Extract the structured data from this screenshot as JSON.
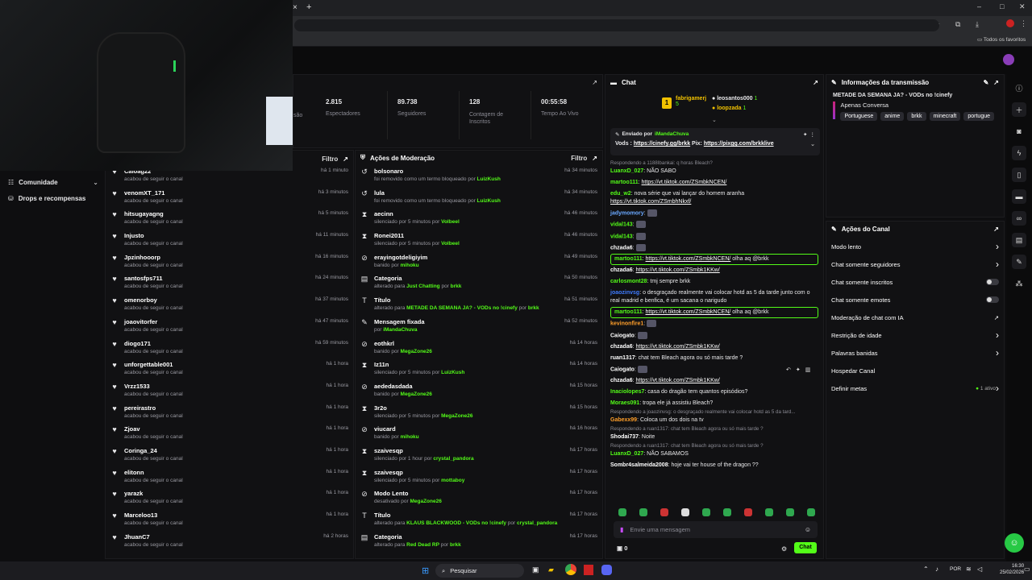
{
  "browser": {
    "bookmarks_label": "Todos os favoritos",
    "close_tab": "×",
    "new_tab": "+"
  },
  "stats": [
    {
      "value": "2.815",
      "label": "Espectadores"
    },
    {
      "value": "89.738",
      "label": "Seguidores"
    },
    {
      "value": "128",
      "label": "Contagem de Inscritos"
    },
    {
      "value": "00:55:58",
      "label": "Tempo Ao Vivo"
    }
  ],
  "stats_cut_label": "são",
  "leftnav": {
    "items": [
      {
        "label": "Comunidade"
      },
      {
        "label": "Drops e recompensas"
      }
    ]
  },
  "follows": {
    "filter": "Filtro",
    "rows": [
      {
        "name": "Caioag22",
        "action": "acabou de seguir o canal",
        "time": "há 1 minuto"
      },
      {
        "name": "venomXT_171",
        "action": "acabou de seguir o canal",
        "time": "há 3 minutos"
      },
      {
        "name": "hitsugayagng",
        "action": "acabou de seguir o canal",
        "time": "há 5 minutos"
      },
      {
        "name": "Injusto",
        "action": "acabou de seguir o canal",
        "time": "há 11 minutos"
      },
      {
        "name": "Jpzinhooorp",
        "action": "acabou de seguir o canal",
        "time": "há 16 minutos"
      },
      {
        "name": "santosfps711",
        "action": "acabou de seguir o canal",
        "time": "há 24 minutos"
      },
      {
        "name": "omenorboy",
        "action": "acabou de seguir o canal",
        "time": "há 37 minutos"
      },
      {
        "name": "joaovitorfer",
        "action": "acabou de seguir o canal",
        "time": "há 47 minutos"
      },
      {
        "name": "diogo171",
        "action": "acabou de seguir o canal",
        "time": "há 59 minutos"
      },
      {
        "name": "unforgettable001",
        "action": "acabou de seguir o canal",
        "time": "há 1 hora"
      },
      {
        "name": "Vrzz1533",
        "action": "acabou de seguir o canal",
        "time": "há 1 hora"
      },
      {
        "name": "pereirastro",
        "action": "acabou de seguir o canal",
        "time": "há 1 hora"
      },
      {
        "name": "Zjoav",
        "action": "acabou de seguir o canal",
        "time": "há 1 hora"
      },
      {
        "name": "Coringa_24",
        "action": "acabou de seguir o canal",
        "time": "há 1 hora"
      },
      {
        "name": "elitonn",
        "action": "acabou de seguir o canal",
        "time": "há 1 hora"
      },
      {
        "name": "yarazk",
        "action": "acabou de seguir o canal",
        "time": "há 1 hora"
      },
      {
        "name": "Marceloo13",
        "action": "acabou de seguir o canal",
        "time": "há 1 hora"
      },
      {
        "name": "JhuanC7",
        "action": "acabou de seguir o canal",
        "time": "há 2 horas"
      }
    ]
  },
  "mod": {
    "title": "Ações de Moderação",
    "filter": "Filtro",
    "rows": [
      {
        "icon": "↺",
        "name": "bolsonaro",
        "pre": "foi removido como um termo bloqueado por ",
        "by": "LuizKush",
        "mid": "",
        "extra": "",
        "time": "há 34 minutos"
      },
      {
        "icon": "↺",
        "name": "lula",
        "pre": "foi removido como um termo bloqueado por ",
        "by": "LuizKush",
        "mid": "",
        "extra": "",
        "time": "há 34 minutos"
      },
      {
        "icon": "⧗",
        "name": "aecinn",
        "pre": "silenciado por 5 minutos por ",
        "by": "Volbeel",
        "mid": "",
        "extra": "",
        "time": "há 46 minutos"
      },
      {
        "icon": "⧗",
        "name": "Ronei2011",
        "pre": "silenciado por 5 minutos por ",
        "by": "Volbeel",
        "mid": "",
        "extra": "",
        "time": "há 46 minutos"
      },
      {
        "icon": "⊘",
        "name": "erayingotdeligiyim",
        "pre": "banido por ",
        "by": "mihoku",
        "mid": "",
        "extra": "",
        "time": "há 49 minutos"
      },
      {
        "icon": "▤",
        "name": "Categoria",
        "pre": "alterado para ",
        "by": "Just Chatting",
        "mid": " por ",
        "extra": "brkk",
        "time": "há 50 minutos"
      },
      {
        "icon": "T",
        "name": "Título",
        "pre": "alterado para ",
        "by": "METADE DA SEMANA JA? - VODs no !cinefy",
        "mid": " por ",
        "extra": "brkk",
        "time": "há 51 minutos"
      },
      {
        "icon": "✎",
        "name": "Mensagem fixada",
        "pre": "por ",
        "by": "iMandaChuva",
        "mid": "",
        "extra": "",
        "time": "há 52 minutos"
      },
      {
        "icon": "⊘",
        "name": "eothkrl",
        "pre": "banido por ",
        "by": "MegaZone26",
        "mid": "",
        "extra": "",
        "time": "há 14 horas"
      },
      {
        "icon": "⧗",
        "name": "Iz11n",
        "pre": "silenciado por 5 minutos por ",
        "by": "LuizKush",
        "mid": "",
        "extra": "",
        "time": "há 14 horas"
      },
      {
        "icon": "⊘",
        "name": "aededasdada",
        "pre": "banido por ",
        "by": "MegaZone26",
        "mid": "",
        "extra": "",
        "time": "há 15 horas"
      },
      {
        "icon": "⧗",
        "name": "3r2o",
        "pre": "silenciado por 5 minutos por ",
        "by": "MegaZone26",
        "mid": "",
        "extra": "",
        "time": "há 15 horas"
      },
      {
        "icon": "⊘",
        "name": "viucard",
        "pre": "banido por ",
        "by": "mihoku",
        "mid": "",
        "extra": "",
        "time": "há 16 horas"
      },
      {
        "icon": "⧗",
        "name": "szaivesqp",
        "pre": "silenciado por 1 hour por ",
        "by": "crystal_pandora",
        "mid": "",
        "extra": "",
        "time": "há 17 horas"
      },
      {
        "icon": "⧗",
        "name": "szaivesqp",
        "pre": "silenciado por 5 minutos por ",
        "by": "mottaboy",
        "mid": "",
        "extra": "",
        "time": "há 17 horas"
      },
      {
        "icon": "⊘",
        "name": "Modo Lento",
        "pre": "desativado por ",
        "by": "MegaZone26",
        "mid": "",
        "extra": "",
        "time": "há 17 horas"
      },
      {
        "icon": "T",
        "name": "Título",
        "pre": "alterado para ",
        "by": "KLAUS BLACKWOOD - VODs no !cinefy",
        "mid": " por ",
        "extra": "crystal_pandora",
        "time": "há 17 horas"
      },
      {
        "icon": "▤",
        "name": "Categoria",
        "pre": "alterado para ",
        "by": "Red Dead RP",
        "mid": " por ",
        "extra": "brkk",
        "time": "há 17 horas"
      }
    ]
  },
  "chat": {
    "title": "Chat",
    "top": [
      {
        "name": "fabrigamerj",
        "count": "5"
      },
      {
        "name": "leosantos000",
        "count": "1"
      },
      {
        "name": "loopzada",
        "count": "1"
      }
    ],
    "top_rank": "1",
    "pinned": {
      "by_label": "Enviado por",
      "by": "iMandaChuva",
      "text": "Vods : ",
      "link1": "https://cinefy.gg/brkk",
      "mid": " Pix: ",
      "link2": "https://pixgg.com/brkklive"
    },
    "messages": [
      {
        "reply": "Respondendo a 1188Ibankai: q horas Bleach?",
        "user": "LuanxD_027",
        "color": "#53fc18",
        "text": "NÃO SABO",
        "link": "",
        "after": "",
        "hl": false
      },
      {
        "reply": "",
        "user": "martoo111",
        "color": "#53fc18",
        "text": "",
        "link": "https://vt.tiktok.com/ZSmbkNCEN/",
        "after": "",
        "hl": false
      },
      {
        "reply": "",
        "user": "edu_w2",
        "color": "#53fc18",
        "text": "nova série que vai lançar do homem aranha",
        "link": "https://vt.tiktok.com/ZSmbhNkxf/",
        "after": "",
        "hl": false
      },
      {
        "reply": "",
        "user": "jadymomory",
        "color": "#6aa8ff",
        "text": "",
        "link": "",
        "after": "",
        "hl": false
      },
      {
        "reply": "",
        "user": "vidal143",
        "color": "#53fc18",
        "text": "",
        "link": "",
        "after": "",
        "hl": false
      },
      {
        "reply": "",
        "user": "vidal143",
        "color": "#53fc18",
        "text": "",
        "link": "",
        "after": "",
        "hl": false
      },
      {
        "reply": "",
        "user": "chzada6",
        "color": "#ffffff",
        "text": "",
        "link": "",
        "after": "",
        "hl": false
      },
      {
        "reply": "",
        "user": "martoo111",
        "color": "#53fc18",
        "text": "",
        "link": "https://vt.tiktok.com/ZSmbkNCEN/",
        "after": " olha aq @brkk",
        "hl": true
      },
      {
        "reply": "",
        "user": "chzada6",
        "color": "#ffffff",
        "text": "",
        "link": "https://vt.tiktok.com/ZSmbk1KKw/",
        "after": "",
        "hl": false
      },
      {
        "reply": "",
        "user": "carlosmont28",
        "color": "#53fc18",
        "text": "tmj sempre brkk",
        "link": "",
        "after": "",
        "hl": false
      },
      {
        "reply": "",
        "user": "joaozinvsg",
        "color": "#3f7cff",
        "text": "o desgraçado realmente vai colocar hotd as 5 da tarde junto com o real madrid e benfica, é um sacana o narigudo",
        "link": "",
        "after": "",
        "hl": false
      },
      {
        "reply": "",
        "user": "martoo111",
        "color": "#53fc18",
        "text": "",
        "link": "https://vt.tiktok.com/ZSmbkNCEN/",
        "after": " olha aq @brkk",
        "hl": true
      },
      {
        "reply": "",
        "user": "kevinonfire1",
        "color": "#ff9f2a",
        "text": "",
        "link": "",
        "after": "",
        "hl": false
      },
      {
        "reply": "",
        "user": "Caiogato",
        "color": "#ffffff",
        "text": "",
        "link": "",
        "after": "",
        "hl": false
      },
      {
        "reply": "",
        "user": "chzada6",
        "color": "#ffffff",
        "text": "",
        "link": "https://vt.tiktok.com/ZSmbk1KKw/",
        "after": "",
        "hl": false
      },
      {
        "reply": "",
        "user": "ruan1317",
        "color": "#ffffff",
        "text": "chat tem Bleach agora ou só mais tarde ?",
        "link": "",
        "after": "",
        "hl": false
      },
      {
        "reply": "",
        "user": "Caiogato",
        "color": "#ffffff",
        "text": "",
        "link": "",
        "after": "",
        "hl": false
      },
      {
        "reply": "",
        "user": "chzada6",
        "color": "#ffffff",
        "text": "",
        "link": "https://vt.tiktok.com/ZSmbk1KKw/",
        "after": "",
        "hl": false
      },
      {
        "reply": "",
        "user": "Inaciolopes7",
        "color": "#53fc18",
        "text": "casa do dragão tem quantos episódios?",
        "link": "",
        "after": "",
        "hl": false
      },
      {
        "reply": "",
        "user": "Moraes091",
        "color": "#53fc18",
        "text": "tropa ele já assistiu Bleach?",
        "link": "",
        "after": "",
        "hl": false
      },
      {
        "reply": "Respondendo a joaozinvsg: o desgraçado realmente vai colocar hotd as 5 da tard...",
        "user": "Gabexx99",
        "color": "#ff9f2a",
        "text": "Coloca um dos dois na tv",
        "link": "",
        "after": "",
        "hl": false
      },
      {
        "reply": "Respondendo a ruan1317: chat tem Bleach agora ou só mais tarde ?",
        "user": "Shodai737",
        "color": "#ffffff",
        "text": "Noite",
        "link": "",
        "after": "",
        "hl": false
      },
      {
        "reply": "Respondendo a ruan1317: chat tem Bleach agora ou só mais tarde ?",
        "user": "LuanxD_027",
        "color": "#53fc18",
        "text": "NÃO SABAMOS",
        "link": "",
        "after": "",
        "hl": false
      },
      {
        "reply": "",
        "user": "Sombr4salmeida2008",
        "color": "#ffffff",
        "text": "hoje vai ter house of the dragon ??",
        "link": "",
        "after": "",
        "hl": false
      }
    ],
    "input_placeholder": "Envie uma mensagem",
    "points": "0",
    "send": "Chat"
  },
  "info": {
    "title": "Informações da transmissão",
    "stream_title": "METADE DA SEMANA JA? - VODs no !cinefy",
    "category": "Apenas Conversa",
    "tags": [
      "Portuguese",
      "anime",
      "brkk",
      "minecraft",
      "portugue"
    ]
  },
  "actions": {
    "title": "Ações do Canal",
    "items": [
      {
        "label": "Modo lento",
        "ctl": "chevron"
      },
      {
        "label": "Chat somente seguidores",
        "ctl": "chevron"
      },
      {
        "label": "Chat somente inscritos",
        "ctl": "toggle"
      },
      {
        "label": "Chat somente emotes",
        "ctl": "toggle"
      },
      {
        "label": "Moderação de chat com IA",
        "ctl": "external"
      },
      {
        "label": "Restrição de idade",
        "ctl": "chevron"
      },
      {
        "label": "Palavras banidas",
        "ctl": "chevron"
      },
      {
        "label": "Hospedar Canal",
        "ctl": "none"
      },
      {
        "label": "Definir metas",
        "ctl": "badge",
        "badge": "1 ativo"
      }
    ]
  },
  "taskbar": {
    "search": "Pesquisar",
    "lang": "POR",
    "time": "16:30",
    "date": "25/02/2026"
  },
  "colors": {
    "accent": "#53fc18",
    "bg": "#0e0e10"
  }
}
